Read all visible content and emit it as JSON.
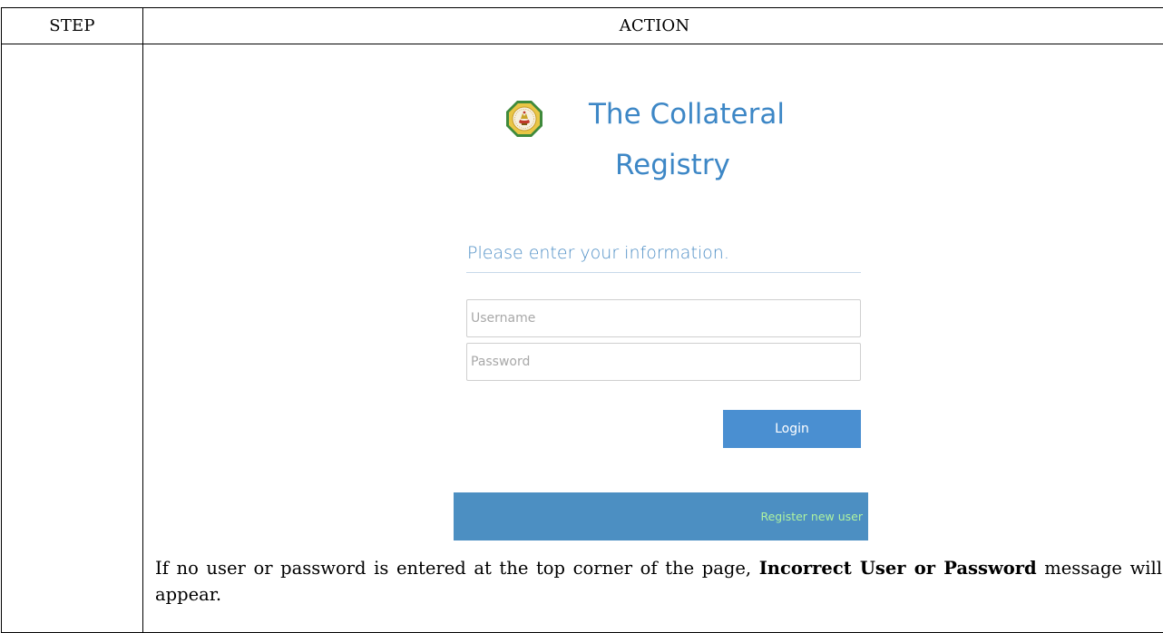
{
  "table": {
    "header_step": "STEP",
    "header_action": "ACTION"
  },
  "login_screen": {
    "logo_icon": "collateral-registry-seal-icon",
    "brand_line_1": "The Collateral",
    "brand_line_2": "Registry",
    "prompt": "Please enter your information.",
    "username_placeholder": "Username",
    "password_placeholder": "Password",
    "login_label": "Login",
    "register_label": "Register new user",
    "colors": {
      "brand": "#3d87c6",
      "login_button": "#4a8fd1",
      "register_bar": "#4c8fc2",
      "register_text": "#aef2a0"
    }
  },
  "instruction": {
    "text_before": "If no user or password is entered at the top corner of the page, ",
    "bold_text": "Incorrect User or Password",
    "text_after": " message will appear."
  }
}
